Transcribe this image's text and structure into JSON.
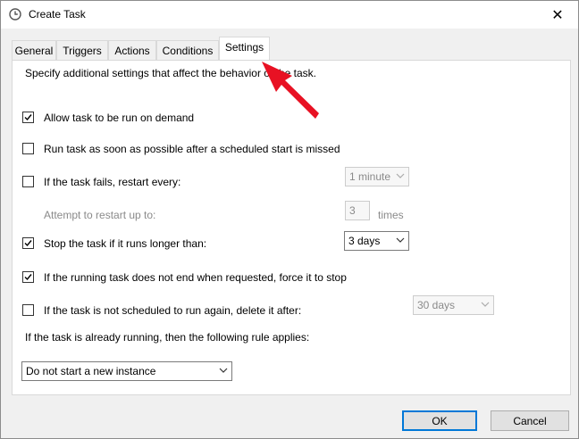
{
  "window": {
    "title": "Create Task",
    "close_glyph": "✕"
  },
  "tabs": [
    {
      "label": "General"
    },
    {
      "label": "Triggers"
    },
    {
      "label": "Actions"
    },
    {
      "label": "Conditions"
    },
    {
      "label": "Settings",
      "active": true
    }
  ],
  "settings": {
    "description": "Specify additional settings that affect the behavior of the task.",
    "allow_on_demand": {
      "label": "Allow task to be run on demand",
      "checked": true
    },
    "run_asap": {
      "label": "Run task as soon as possible after a scheduled start is missed",
      "checked": false
    },
    "restart_on_fail": {
      "label": "If the task fails, restart every:",
      "checked": false,
      "interval": "1 minute"
    },
    "restart_attempts": {
      "label": "Attempt to restart up to:",
      "value": "3",
      "unit": "times"
    },
    "stop_if_longer": {
      "label": "Stop the task if it runs longer than:",
      "checked": true,
      "duration": "3 days"
    },
    "force_stop": {
      "label": "If the running task does not end when requested, force it to stop",
      "checked": true
    },
    "delete_after": {
      "label": "If the task is not scheduled to run again, delete it after:",
      "checked": false,
      "duration": "30 days"
    },
    "running_rule_label": "If the task is already running, then the following rule applies:",
    "running_rule_value": "Do not start a new instance"
  },
  "buttons": {
    "ok": "OK",
    "cancel": "Cancel"
  },
  "colors": {
    "accent": "#0078d7",
    "annotation_arrow": "#e81123"
  },
  "annotation": {
    "type": "red-arrow",
    "points_to": "Settings tab"
  }
}
